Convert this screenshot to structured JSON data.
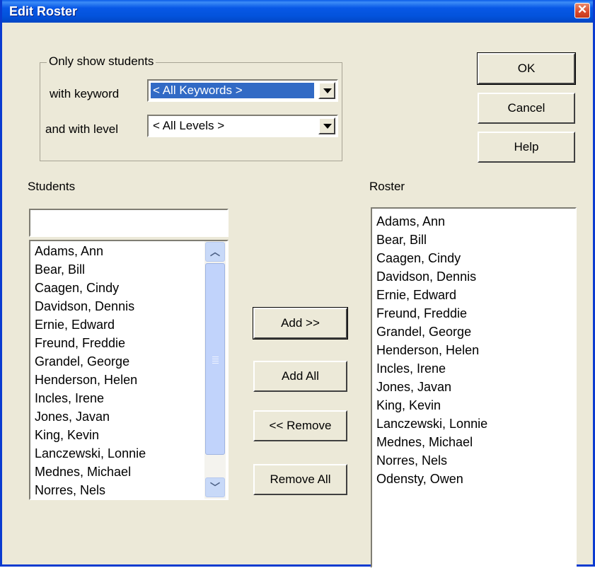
{
  "window": {
    "title": "Edit Roster"
  },
  "filter": {
    "group_label": "Only show students",
    "keyword_label": "with keyword",
    "keyword_value": "< All Keywords >",
    "level_label": "and with level",
    "level_value": "< All Levels >"
  },
  "buttons": {
    "ok": "OK",
    "cancel": "Cancel",
    "help": "Help",
    "add": "Add >>",
    "add_all": "Add All",
    "remove": "<< Remove",
    "remove_all": "Remove All"
  },
  "students": {
    "label": "Students",
    "search_value": "",
    "items": [
      "Adams, Ann",
      "Bear, Bill",
      "Caagen, Cindy",
      "Davidson, Dennis",
      "Ernie, Edward",
      "Freund, Freddie",
      "Grandel, George",
      "Henderson, Helen",
      "Incles, Irene",
      "Jones, Javan",
      "King, Kevin",
      "Lanczewski, Lonnie",
      "Mednes, Michael",
      "Norres, Nels"
    ]
  },
  "roster": {
    "label": "Roster",
    "items": [
      "Adams, Ann",
      "Bear, Bill",
      "Caagen, Cindy",
      "Davidson, Dennis",
      "Ernie, Edward",
      "Freund, Freddie",
      "Grandel, George",
      "Henderson, Helen",
      "Incles, Irene",
      "Jones, Javan",
      "King, Kevin",
      "Lanczewski, Lonnie",
      "Mednes, Michael",
      "Norres, Nels",
      "Odensty, Owen"
    ]
  },
  "colors": {
    "titlebar": "#0a5ce8",
    "selection": "#316ac5",
    "dialog_bg": "#ece9d8"
  }
}
